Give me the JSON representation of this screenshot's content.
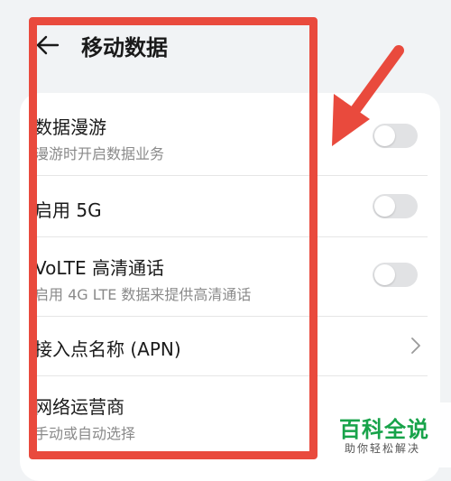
{
  "header": {
    "title": "移动数据",
    "back_icon": "back-arrow-icon"
  },
  "settings": [
    {
      "title": "数据漫游",
      "subtitle": "漫游时开启数据业务",
      "control": "toggle",
      "state": "off"
    },
    {
      "title": "启用 5G",
      "control": "toggle",
      "state": "off"
    },
    {
      "title": "VoLTE 高清通话",
      "subtitle": "启用 4G LTE 数据来提供高清通话",
      "control": "toggle",
      "state": "off"
    },
    {
      "title": "接入点名称 (APN)",
      "control": "chevron",
      "icon": "chevron-right-icon"
    },
    {
      "title": "网络运营商",
      "subtitle": "手动或自动选择"
    }
  ],
  "watermark": {
    "main": "百科全说",
    "sub": "助你轻松解决"
  },
  "colors": {
    "background": "#f1f3f5",
    "card": "#ffffff",
    "toggle_off": "#e1e2e4",
    "annotation_red": "#e94a3d",
    "watermark_green": "#18a34a"
  }
}
